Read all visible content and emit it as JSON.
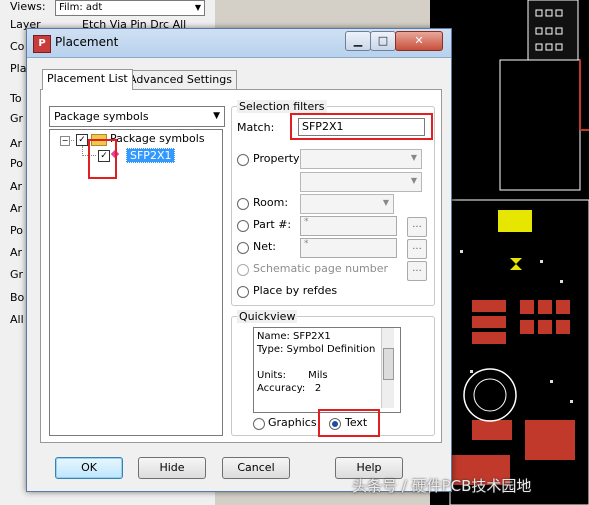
{
  "background": {
    "views_label": "Views:",
    "views_value": "Film: adt",
    "layer_label": "Layer",
    "layer_columns": "Etch  Via  Pin  Drc  All",
    "side_labels": [
      "Co",
      "Pla",
      "To",
      "Gr",
      "Ar",
      "Po",
      "Ar",
      "Ar",
      "Po",
      "Ar",
      "Gr",
      "Bo",
      "All"
    ]
  },
  "dialog": {
    "title": "Placement",
    "window_buttons": {
      "minimize": "▁",
      "maximize": "□",
      "close": "✕"
    },
    "tabs": [
      {
        "label": "Placement List",
        "active": true
      },
      {
        "label": "Advanced Settings",
        "active": false
      }
    ],
    "list_source": {
      "selected": "Package symbols"
    },
    "tree": {
      "root": {
        "label": "Package symbols",
        "checked": true
      },
      "children": [
        {
          "label": "SFP2X1",
          "checked": true,
          "selected": true
        }
      ]
    },
    "selection_filters": {
      "title": "Selection filters",
      "match_label": "Match:",
      "match_value": "SFP2X1",
      "property_label": "Property:",
      "room_label": "Room:",
      "part_label": "Part #:",
      "part_value": "*",
      "net_label": "Net:",
      "net_value": "*",
      "schematic_label": "Schematic page number",
      "refdes_label": "Place by refdes",
      "browse_label": "..."
    },
    "quickview": {
      "title": "Quickview",
      "lines": [
        "Name: SFP2X1",
        "Type: Symbol Definition",
        "",
        "Units:       Mils",
        "Accuracy:   2"
      ],
      "graphics_label": "Graphics",
      "text_label": "Text",
      "selected": "Text"
    },
    "buttons": {
      "ok": "OK",
      "hide": "Hide",
      "cancel": "Cancel",
      "help": "Help"
    }
  },
  "watermark": "头条号 / 硬件PCB技术园地",
  "colors": {
    "annotation": "#e02020",
    "selection": "#3399ff",
    "pcb_bg": "#000000",
    "pcb_pad": "#c0392b",
    "pcb_line": "#ffffff"
  }
}
